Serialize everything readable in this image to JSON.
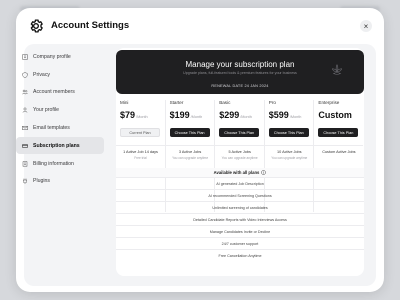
{
  "modal": {
    "title": "Account Settings",
    "close_label": "×"
  },
  "sidebar": {
    "items": [
      {
        "label": "Company profile",
        "icon": "building-icon",
        "active": false
      },
      {
        "label": "Privacy",
        "icon": "shield-icon",
        "active": false
      },
      {
        "label": "Account members",
        "icon": "users-icon",
        "active": false
      },
      {
        "label": "Your profile",
        "icon": "user-icon",
        "active": false
      },
      {
        "label": "Email templates",
        "icon": "mail-icon",
        "active": false
      },
      {
        "label": "Subscription plans",
        "icon": "card-icon",
        "active": true
      },
      {
        "label": "Billing information",
        "icon": "receipt-icon",
        "active": false
      },
      {
        "label": "Plugins",
        "icon": "plug-icon",
        "active": false
      }
    ]
  },
  "hero": {
    "title": "Manage your subscription plan",
    "subtitle": "Upgrade plans, full-featured tools & premium features for your business",
    "renewal": "RENEWAL DATE 24 JAN 2024"
  },
  "plans": [
    {
      "name": "Mini",
      "price": "$79",
      "period": "/Month",
      "button": "Current Plan",
      "button_style": "light",
      "jobs": "1 Active Job 14 days",
      "note": "Free trial"
    },
    {
      "name": "Starter",
      "price": "$199",
      "period": "/Month",
      "button": "Choose This Plan",
      "button_style": "dark",
      "jobs": "3 Active Jobs",
      "note": "You can upgrade anytime"
    },
    {
      "name": "Basic",
      "price": "$299",
      "period": "/Month",
      "button": "Choose This Plan",
      "button_style": "dark",
      "jobs": "5 Active Jobs",
      "note": "You can upgrade anytime"
    },
    {
      "name": "Pro",
      "price": "$599",
      "period": "/Month",
      "button": "Choose This Plan",
      "button_style": "dark",
      "jobs": "10 Active Jobs",
      "note": "You can upgrade anytime"
    },
    {
      "name": "Enterprise",
      "price": "Custom",
      "period": "",
      "button": "Choose This Plan",
      "button_style": "dark",
      "jobs": "Custom Active Jobs",
      "note": ""
    }
  ],
  "features": {
    "heading": "Available with all plans",
    "items": [
      "AI generated Job Description",
      "AI recommended Screening Questions",
      "Unlimited screening of candidates",
      "Detailed Candidate Reports with Video Interviews Access",
      "Manage Candidates Invite or Decline",
      "24/7 customer support",
      "Free Cancellation Anytime"
    ]
  }
}
